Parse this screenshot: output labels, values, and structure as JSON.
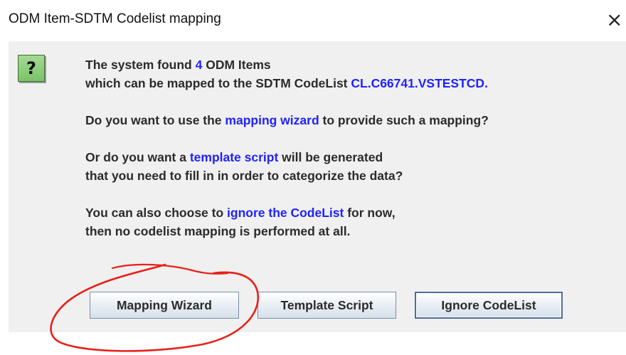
{
  "window": {
    "title": "ODM Item-SDTM Codelist mapping",
    "close_glyph": "×"
  },
  "icon": {
    "name": "question-icon",
    "glyph": "?",
    "color": "#7cc36a"
  },
  "message": {
    "line1_pre": "The system found ",
    "line1_count": "4",
    "line1_post": " ODM Items",
    "line2_pre": "which can be mapped to the SDTM CodeList ",
    "line2_codelist": "CL.C66741.VSTESTCD.",
    "line3_pre": "Do you want to use the ",
    "line3_link": "mapping wizard",
    "line3_post": " to provide such a mapping?",
    "line4_pre": "Or do you want a ",
    "line4_link": "template script",
    "line4_post": " will be generated",
    "line5": "that you need to fill in in order to categorize the data?",
    "line6_pre": "You can also choose to ",
    "line6_link": "ignore the CodeList",
    "line6_post": " for now,",
    "line7": "then no codelist mapping is performed at all."
  },
  "buttons": {
    "mapping_wizard": "Mapping Wizard",
    "template_script": "Template Script",
    "ignore_codelist": "Ignore CodeList"
  },
  "colors": {
    "highlight": "#1f22ff",
    "panel_bg": "#f0f0f0",
    "annotation": "#e8201a"
  }
}
